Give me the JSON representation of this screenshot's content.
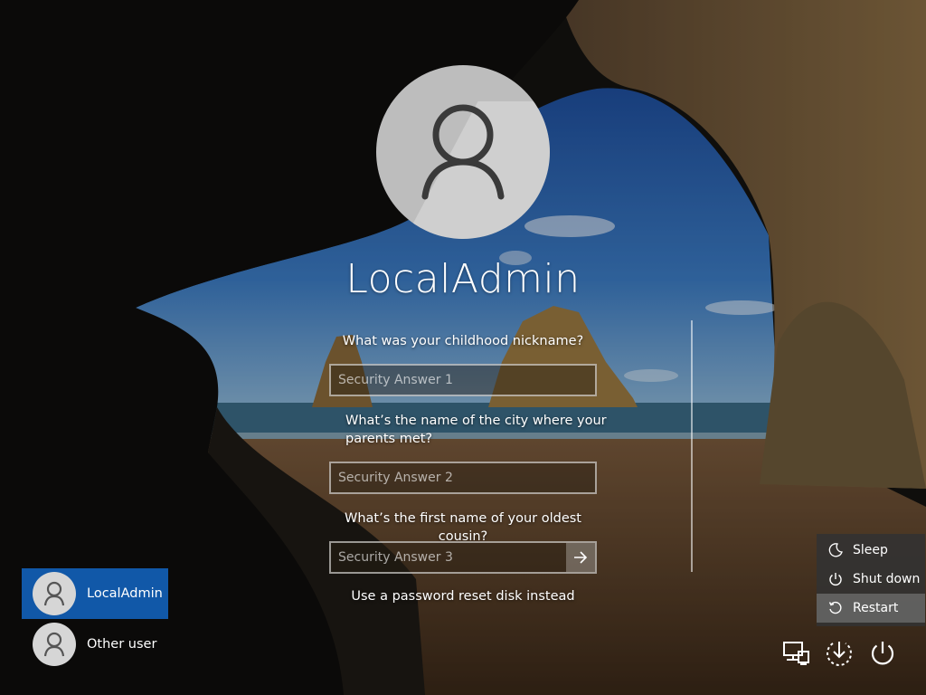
{
  "account": {
    "name": "LocalAdmin"
  },
  "security": {
    "q1": "What was your childhood nickname?",
    "a1_placeholder": "Security Answer 1",
    "q2": "What’s the name of the city where your parents met?",
    "a2_placeholder": "Security Answer 2",
    "q3": "What’s the first name of your oldest cousin?",
    "a3_placeholder": "Security Answer 3",
    "reset_link": "Use a password reset disk instead"
  },
  "users": [
    {
      "label": "LocalAdmin",
      "selected": true
    },
    {
      "label": "Other user",
      "selected": false
    }
  ],
  "power_menu": {
    "items": [
      {
        "label": "Sleep",
        "icon": "moon-icon"
      },
      {
        "label": "Shut down",
        "icon": "power-icon"
      },
      {
        "label": "Restart",
        "icon": "restart-icon"
      }
    ]
  },
  "icons": {
    "network": "network-icon",
    "ease_of_access": "ease-of-access-icon",
    "power": "power-icon"
  },
  "colors": {
    "selected_user": "#1158a8"
  }
}
